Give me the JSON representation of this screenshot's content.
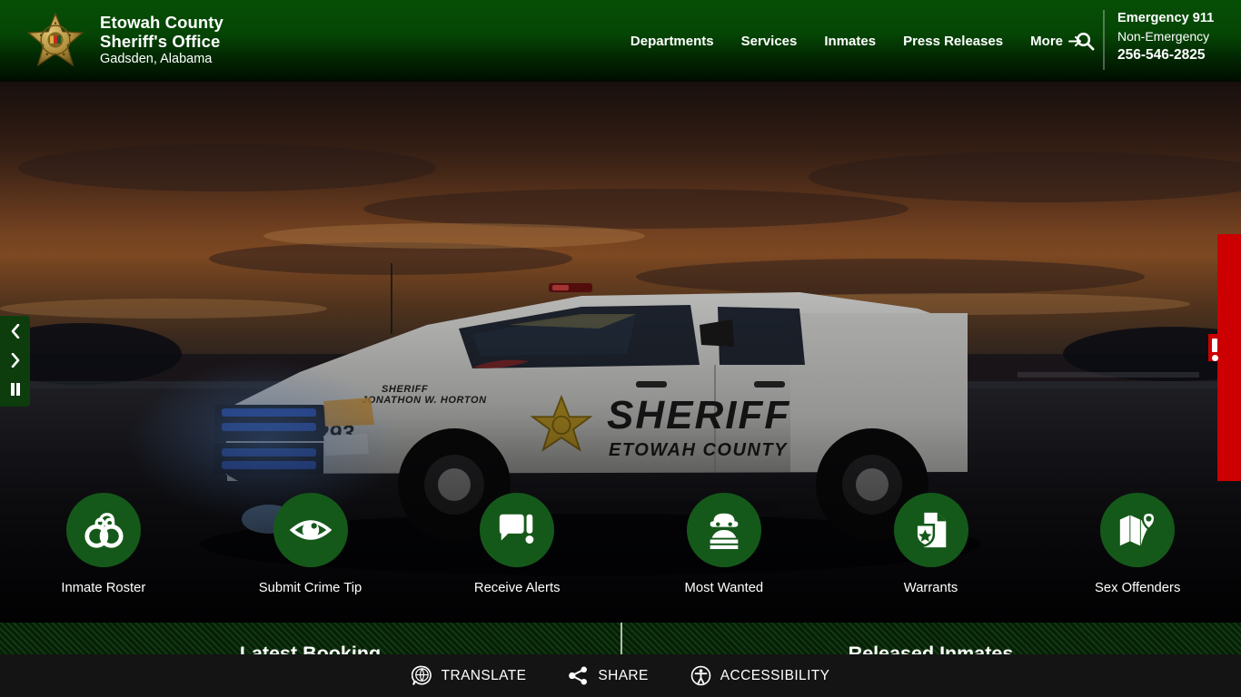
{
  "header": {
    "logo_icon": "sheriff-star-badge-icon",
    "brand_line1": "Etowah County",
    "brand_line2": "Sheriff's Office",
    "brand_line3": "Gadsden, Alabama",
    "nav": [
      {
        "label": "Departments",
        "icon": null
      },
      {
        "label": "Services",
        "icon": null
      },
      {
        "label": "Inmates",
        "icon": null
      },
      {
        "label": "Press Releases",
        "icon": null
      },
      {
        "label": "More",
        "icon": "arrow-right-icon"
      }
    ],
    "search_icon": "search-icon",
    "emergency": {
      "line1": "Emergency 911",
      "line2": "Non-Emergency",
      "line3": "256-546-2825"
    }
  },
  "hero": {
    "carousel": {
      "prev_icon": "chevron-left-icon",
      "next_icon": "chevron-right-icon",
      "pause_icon": "pause-icon"
    },
    "alert_tab": {
      "icon": "exclamation-icon"
    },
    "vehicle": {
      "door_text_line1": "SHERIFF",
      "door_text_line2": "ETOWAH COUNTY",
      "hood_text_line1": "SHERIFF",
      "hood_text_line2": "JONATHON W. HORTON",
      "unit_number": "293"
    }
  },
  "quick_links": [
    {
      "label": "Inmate Roster",
      "icon": "handcuffs-icon"
    },
    {
      "label": "Submit Crime Tip",
      "icon": "eye-icon"
    },
    {
      "label": "Receive Alerts",
      "icon": "speech-bubble-alert-icon"
    },
    {
      "label": "Most Wanted",
      "icon": "burglar-icon"
    },
    {
      "label": "Warrants",
      "icon": "document-shield-star-icon"
    },
    {
      "label": "Sex Offenders",
      "icon": "map-pin-icon"
    }
  ],
  "panels": [
    {
      "title": "Latest Booking"
    },
    {
      "title": "Released Inmates"
    }
  ],
  "bottom_bar": [
    {
      "label": "TRANSLATE",
      "icon": "globe-speech-icon"
    },
    {
      "label": "SHARE",
      "icon": "share-nodes-icon"
    },
    {
      "label": "ACCESSIBILITY",
      "icon": "accessibility-person-icon"
    }
  ],
  "colors": {
    "header_green_top": "#064f06",
    "brand_green": "#15591a",
    "alert_red": "#cc0000",
    "bottom_bar": "#141414",
    "panel_green": "#0a2b0a"
  }
}
